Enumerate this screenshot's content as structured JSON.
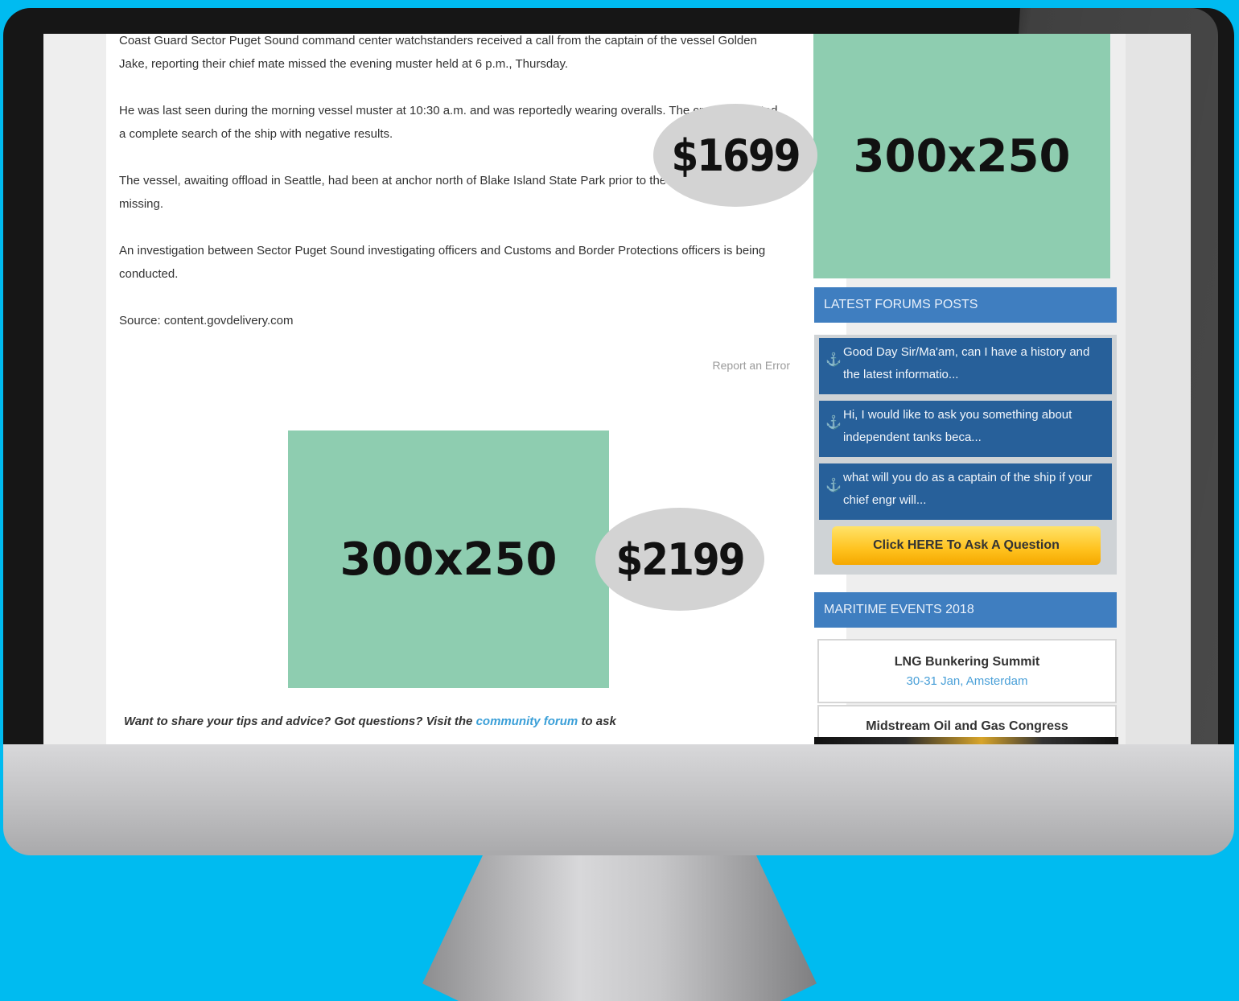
{
  "article": {
    "paragraphs": [
      "Coast Guard Sector Puget Sound command center watchstanders received a call from the captain of the vessel Golden Jake, reporting their chief mate missed the evening muster held at 6 p.m., Thursday.",
      "He was last seen during the morning vessel muster at 10:30 a.m. and was reportedly wearing overalls. The crew conducted a complete search of the ship with negative results.",
      "The vessel, awaiting offload in Seattle, had been at anchor north of Blake Island State Park prior to the crew member going missing.",
      "An investigation between Sector Puget Sound investigating officers and Customs and Border Protections officers is being conducted.",
      "Source: content.govdelivery.com"
    ],
    "report_link": "Report an Error",
    "cta": {
      "before": "Want to share your tips and advice? Got questions? Visit the",
      "link": "community forum",
      "after": "to ask"
    }
  },
  "ads": {
    "sidebar": {
      "size": "300x250",
      "price": "$1699"
    },
    "inline": {
      "size": "300x250",
      "price": "$2199"
    }
  },
  "sidebar": {
    "forums_heading": "LATEST FORUMS POSTS",
    "posts": [
      {
        "text": "Good Day Sir/Ma'am, can I have a history and the latest informatio..."
      },
      {
        "text": "Hi, I would like to ask you something about independent tanks beca..."
      },
      {
        "text": "what will you do as a captain of the ship if your chief engr will..."
      }
    ],
    "ask_button": "Click HERE To Ask A Question",
    "events_heading": "MARITIME EVENTS 2018",
    "events": [
      {
        "name": "LNG Bunkering Summit",
        "meta": "30-31 Jan, Amsterdam"
      },
      {
        "name": "Midstream Oil and Gas Congress",
        "meta": ""
      }
    ]
  },
  "colors": {
    "background": "#00bbf0",
    "ad_fill": "#8ecdb0",
    "price_bubble": "#d3d3d3",
    "sidebar_heading": "#3f7ec0",
    "forum_post": "#27609a",
    "button_yellow": "#ffc21e",
    "link_blue": "#3a9fd8"
  },
  "icons": {
    "forum_post": "anchor-icon"
  }
}
